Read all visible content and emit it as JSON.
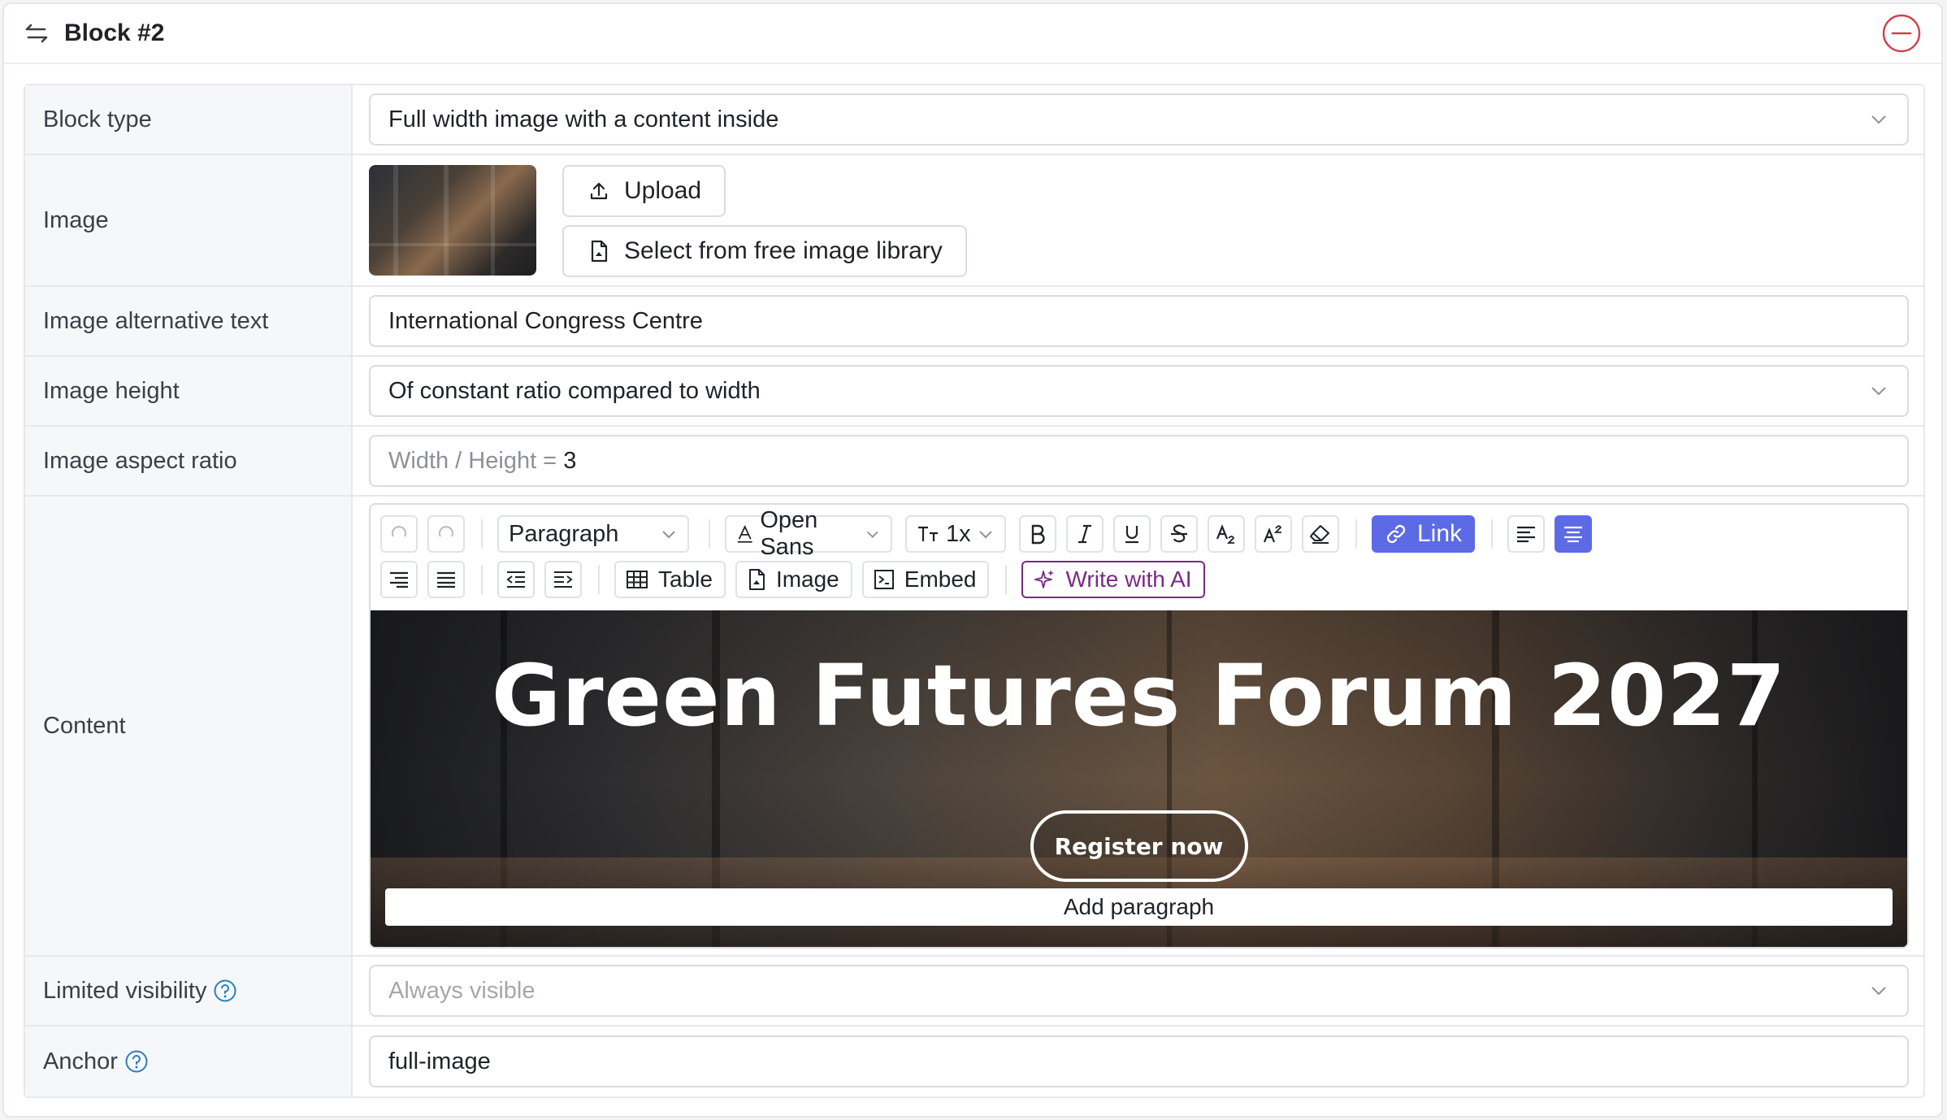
{
  "header": {
    "title": "Block #2"
  },
  "fields": {
    "block_type": {
      "label": "Block type",
      "value": "Full width image with a content inside"
    },
    "image": {
      "label": "Image",
      "upload": "Upload",
      "library": "Select from free image library"
    },
    "alt_text": {
      "label": "Image alternative text",
      "value": "International Congress Centre"
    },
    "image_height": {
      "label": "Image height",
      "value": "Of constant ratio compared to width"
    },
    "aspect_ratio": {
      "label": "Image aspect ratio",
      "prefix": "Width / Height = ",
      "value": "3"
    },
    "content": {
      "label": "Content"
    },
    "visibility": {
      "label": "Limited visibility",
      "placeholder": "Always visible"
    },
    "anchor": {
      "label": "Anchor",
      "value": "full-image"
    }
  },
  "toolbar": {
    "paragraph": "Paragraph",
    "font": "Open Sans",
    "size": "1x",
    "link": "Link",
    "table": "Table",
    "image": "Image",
    "embed": "Embed",
    "ai": "Write with AI"
  },
  "canvas": {
    "headline": "Green Futures Forum 2027",
    "cta": "Register now",
    "add_paragraph": "Add paragraph"
  },
  "colors": {
    "accent": "#5c6ae6",
    "ai": "#7a2a85",
    "danger": "#d0424a",
    "help": "#2a7fc1"
  }
}
